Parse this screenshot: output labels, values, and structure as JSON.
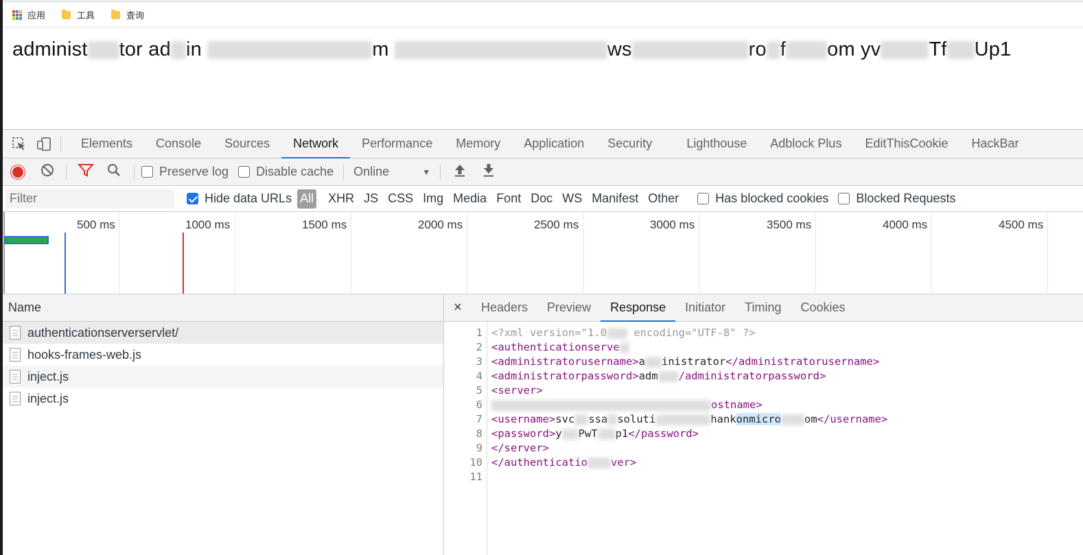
{
  "bookmarks": [
    {
      "label": "应用",
      "icon": "apps-grid-icon"
    },
    {
      "label": "工具",
      "icon": "folder-icon"
    },
    {
      "label": "查询",
      "icon": "folder-icon"
    }
  ],
  "page": {
    "segments": [
      "administ",
      "tor ad",
      "in ",
      "m ",
      "ws",
      "ro",
      "f",
      "om yv",
      "Tf",
      "Up1"
    ]
  },
  "devtools": {
    "tabs": [
      "Elements",
      "Console",
      "Sources",
      "Network",
      "Performance",
      "Memory",
      "Application",
      "Security",
      "Lighthouse",
      "Adblock Plus",
      "EditThisCookie",
      "HackBar"
    ],
    "active_tab": "Network",
    "toolbar": {
      "preserve_log": "Preserve log",
      "disable_cache": "Disable cache",
      "throttle": "Online"
    },
    "filter": {
      "placeholder": "Filter",
      "hide_data_urls": "Hide data URLs",
      "types": [
        "All",
        "XHR",
        "JS",
        "CSS",
        "Img",
        "Media",
        "Font",
        "Doc",
        "WS",
        "Manifest",
        "Other"
      ],
      "has_blocked_cookies": "Has blocked cookies",
      "blocked_requests": "Blocked Requests"
    },
    "timeline": {
      "labels": [
        "500 ms",
        "1000 ms",
        "1500 ms",
        "2000 ms",
        "2500 ms",
        "3000 ms",
        "3500 ms",
        "4000 ms",
        "4500 ms"
      ]
    },
    "requests": {
      "header": "Name",
      "items": [
        "authenticationserverservlet/",
        "hooks-frames-web.js",
        "inject.js",
        "inject.js"
      ]
    },
    "detail": {
      "close": "×",
      "tabs": [
        "Headers",
        "Preview",
        "Response",
        "Initiator",
        "Timing",
        "Cookies"
      ],
      "active_tab": "Response",
      "line_numbers": [
        "1",
        "2",
        "3",
        "4",
        "5",
        "6",
        "7",
        "8",
        "9",
        "10",
        "11"
      ],
      "lines": [
        [
          "<?xml version=\"1.0",
          " encoding=\"UTF-8\" ?>"
        ],
        [
          "<authenticationserve"
        ],
        [
          "<administratorusername>",
          "a",
          "inistrator",
          "</administratorusername>"
        ],
        [
          "<administratorpassword>",
          "adm",
          "/administratorpassword>"
        ],
        [
          "<server>"
        ],
        [
          "ostname>"
        ],
        [
          "<username>",
          "svc",
          "ssa",
          "soluti",
          "hank",
          "onmicro",
          "om",
          "</username>"
        ],
        [
          "<password>",
          "y",
          "PwT",
          "p1",
          "</password>"
        ],
        [
          "</server>"
        ],
        [
          "</authenticatio",
          "ver>"
        ],
        [
          ""
        ]
      ]
    }
  }
}
